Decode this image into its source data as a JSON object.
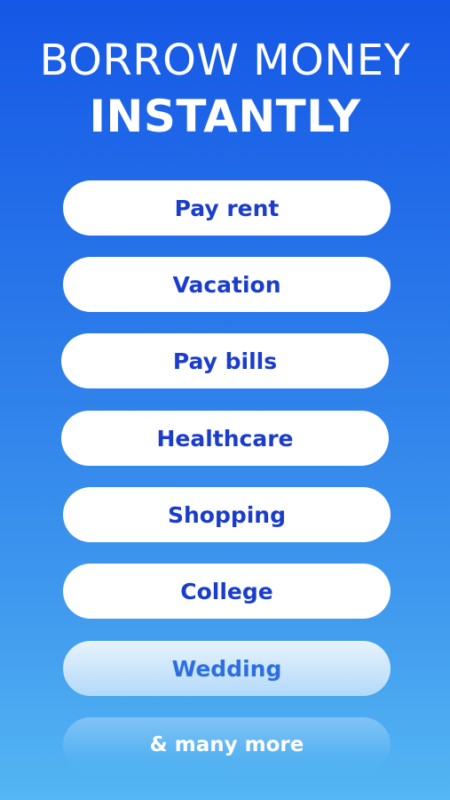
{
  "colors": {
    "background_top": "#1557e6",
    "background_bottom": "#54b6f3",
    "pill_background": "#ffffff",
    "pill_text": "#1a3dcc",
    "title_text": "#ffffff"
  },
  "header": {
    "line1": "BORROW MONEY",
    "line2": "INSTANTLY"
  },
  "options": [
    {
      "label": "Pay rent"
    },
    {
      "label": "Vacation"
    },
    {
      "label": "Pay bills"
    },
    {
      "label": "Healthcare"
    },
    {
      "label": "Shopping"
    },
    {
      "label": "College"
    },
    {
      "label": "Wedding"
    }
  ],
  "footer": {
    "more_label": "& many more"
  }
}
